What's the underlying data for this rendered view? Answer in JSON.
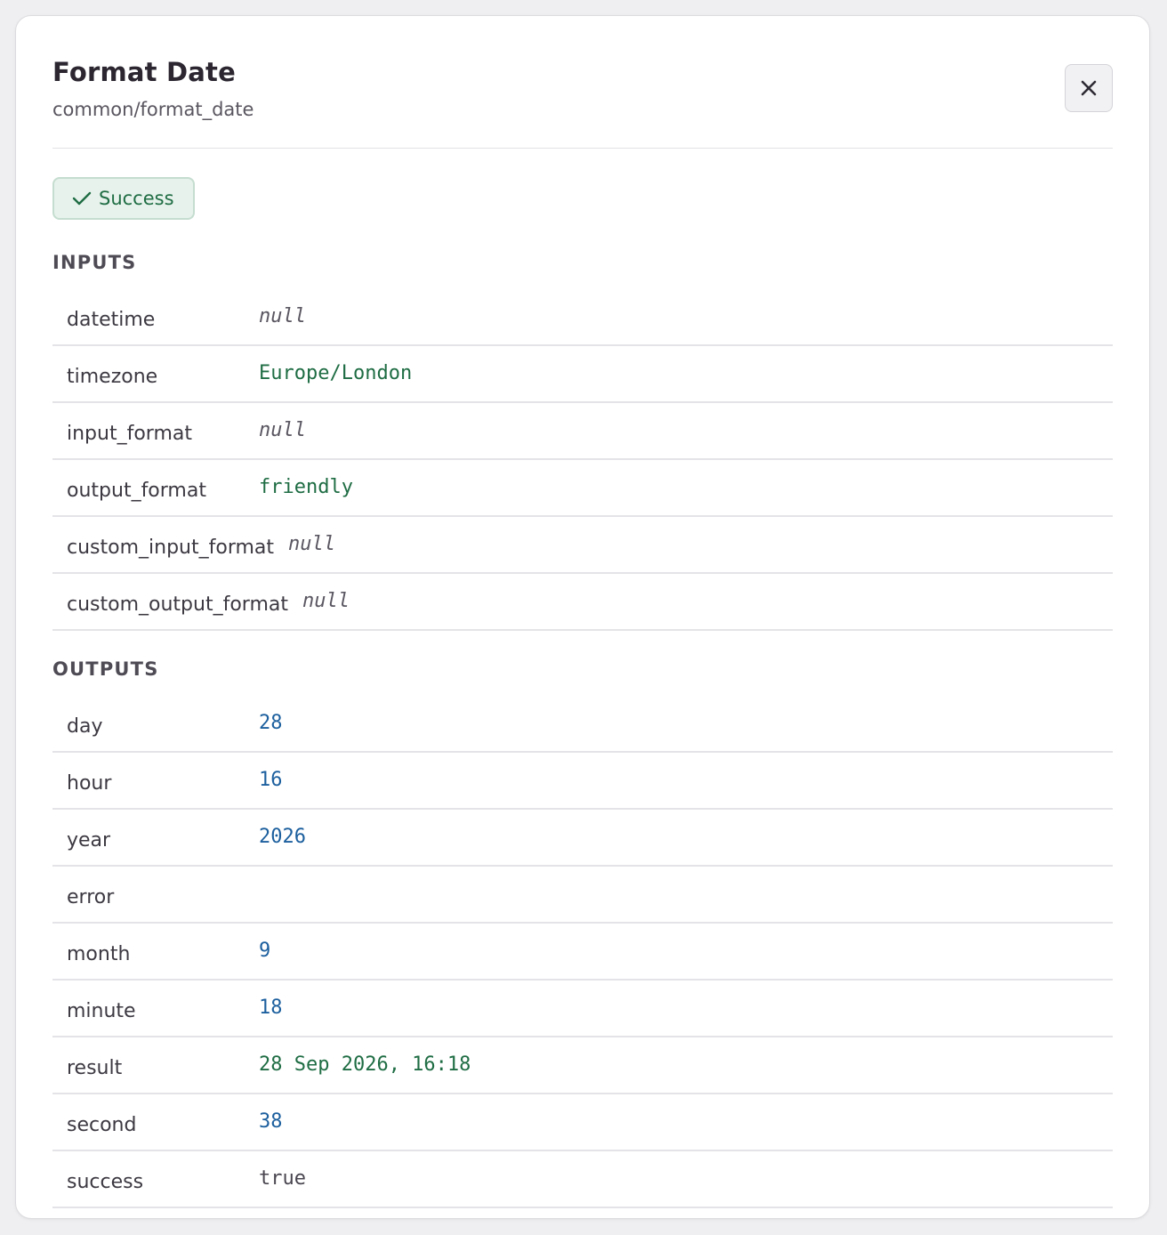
{
  "header": {
    "title": "Format Date",
    "subtitle": "common/format_date",
    "close_icon": "close-icon"
  },
  "status": {
    "label": "Success",
    "icon": "check-icon",
    "color": "#1f6d44",
    "background": "#e7f2ec"
  },
  "inputs": {
    "title": "INPUTS",
    "rows": [
      {
        "key": "datetime",
        "value": "null",
        "type": "null"
      },
      {
        "key": "timezone",
        "value": "Europe/London",
        "type": "string"
      },
      {
        "key": "input_format",
        "value": "null",
        "type": "null"
      },
      {
        "key": "output_format",
        "value": "friendly",
        "type": "string"
      },
      {
        "key": "custom_input_format",
        "value": "null",
        "type": "null"
      },
      {
        "key": "custom_output_format",
        "value": "null",
        "type": "null"
      }
    ]
  },
  "outputs": {
    "title": "OUTPUTS",
    "rows": [
      {
        "key": "day",
        "value": "28",
        "type": "number"
      },
      {
        "key": "hour",
        "value": "16",
        "type": "number"
      },
      {
        "key": "year",
        "value": "2026",
        "type": "number"
      },
      {
        "key": "error",
        "value": "",
        "type": "string"
      },
      {
        "key": "month",
        "value": "9",
        "type": "number"
      },
      {
        "key": "minute",
        "value": "18",
        "type": "number"
      },
      {
        "key": "result",
        "value": "28 Sep 2026, 16:18",
        "type": "string"
      },
      {
        "key": "second",
        "value": "38",
        "type": "number"
      },
      {
        "key": "success",
        "value": "true",
        "type": "boolean"
      }
    ]
  },
  "colors": {
    "string": "#1f6d44",
    "number": "#1c5f9e",
    "null": "#5b5762",
    "boolean": "#4a4650"
  }
}
